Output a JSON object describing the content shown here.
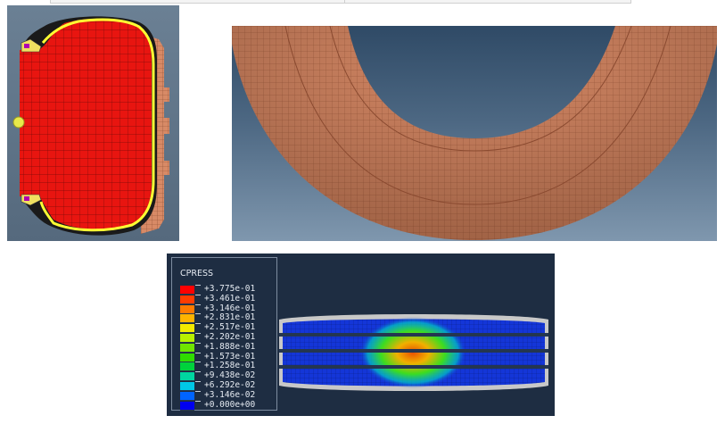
{
  "legend": {
    "title": "CPRESS",
    "entries": [
      {
        "label": "+3.775e-01",
        "color": "#ff0000"
      },
      {
        "label": "+3.461e-01",
        "color": "#ff3c00"
      },
      {
        "label": "+3.146e-01",
        "color": "#ff7a00"
      },
      {
        "label": "+2.831e-01",
        "color": "#ffb400"
      },
      {
        "label": "+2.517e-01",
        "color": "#f2ea00"
      },
      {
        "label": "+2.202e-01",
        "color": "#b8f000"
      },
      {
        "label": "+1.888e-01",
        "color": "#6fe400"
      },
      {
        "label": "+1.573e-01",
        "color": "#2fdc00"
      },
      {
        "label": "+1.258e-01",
        "color": "#00d23c"
      },
      {
        "label": "+9.438e-02",
        "color": "#00d7a0"
      },
      {
        "label": "+6.292e-02",
        "color": "#00c8e6"
      },
      {
        "label": "+3.146e-02",
        "color": "#0064ff"
      },
      {
        "label": "+0.000e+00",
        "color": "#0000f0"
      }
    ]
  },
  "colors": {
    "section_fill": "#ee1111",
    "section_outline": "#ffff33",
    "ring_fill": "#d98a66",
    "contact_base": "#1436d8"
  }
}
